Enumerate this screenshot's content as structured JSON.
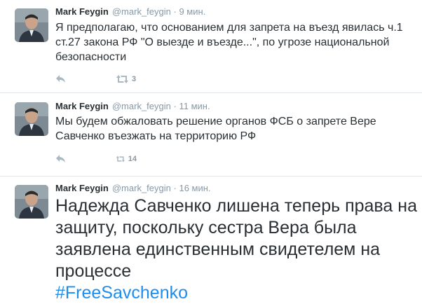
{
  "tweets": [
    {
      "author_name": "Mark Feygin",
      "author_handle": "@mark_feygin",
      "separator": "·",
      "time": "9 мин.",
      "text": "Я предполагаю, что основанием для запрета на въезд явилась ч.1 ст.27 закона РФ \"О выезде и въезде...\", по угрозе национальной безопасности",
      "retweet_count": "3"
    },
    {
      "author_name": "Mark Feygin",
      "author_handle": "@mark_feygin",
      "separator": "·",
      "time": "11 мин.",
      "text": "Мы будем обжаловать решение органов ФСБ о запрете Вере Савченко въезжать на территорию РФ",
      "retweet_count": "14"
    },
    {
      "author_name": "Mark Feygin",
      "author_handle": "@mark_feygin",
      "separator": "·",
      "time": "16 мин.",
      "text": "Надежда Савченко лишена теперь права на защиту, поскольку сестра Вера была заявлена единственным свидетелем на процессе",
      "hashtag": "#FreeSavchenko"
    }
  ],
  "icons": {
    "reply": "reply-icon",
    "retweet": "retweet-icon",
    "avatar": "avatar"
  },
  "colors": {
    "text": "#292f33",
    "muted": "#8899a6",
    "action_icon": "#aab8c2",
    "hashtag": "#1d8dee",
    "divider": "#e1e8ed"
  }
}
